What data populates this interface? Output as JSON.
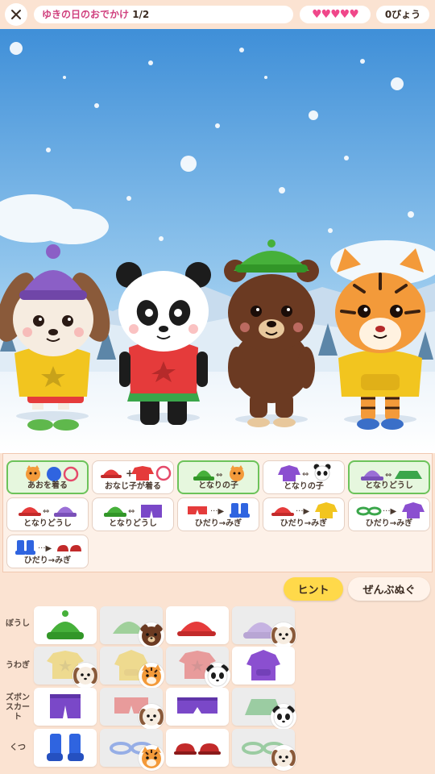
{
  "header": {
    "title": "ゆきの日のおでかけ",
    "level": "1/2",
    "hearts": "♥♥♥♥♥",
    "timer": "0びょう"
  },
  "scene": {
    "characters": [
      "dog",
      "panda",
      "bear",
      "tiger"
    ]
  },
  "rules": [
    {
      "label": "あおを着る",
      "satisfied": true
    },
    {
      "label": "おなじ子が着る",
      "satisfied": false
    },
    {
      "label": "となりの子",
      "satisfied": true
    },
    {
      "label": "となりの子",
      "satisfied": false
    },
    {
      "label": "となりどうし",
      "satisfied": true
    },
    {
      "label": "となりどうし",
      "satisfied": false
    },
    {
      "label": "となりどうし",
      "satisfied": false
    },
    {
      "label": "ひだり→みぎ",
      "satisfied": false
    },
    {
      "label": "ひだり→みぎ",
      "satisfied": false
    },
    {
      "label": "ひだり→みぎ",
      "satisfied": false
    },
    {
      "label": "ひだり→みぎ",
      "satisfied": false
    }
  ],
  "buttons": {
    "hint": "ヒント",
    "undress": "ぜんぶぬぐ"
  },
  "wardrobe": {
    "rows": [
      {
        "label": "ぼうし"
      },
      {
        "label": "うわぎ"
      },
      {
        "label": "ズボン\nスカート"
      },
      {
        "label": "くつ"
      }
    ]
  },
  "colors": {
    "accent_pink": "#d0407e",
    "hint_yellow": "#ffd94a",
    "satisfied_green": "#6cc35a"
  }
}
